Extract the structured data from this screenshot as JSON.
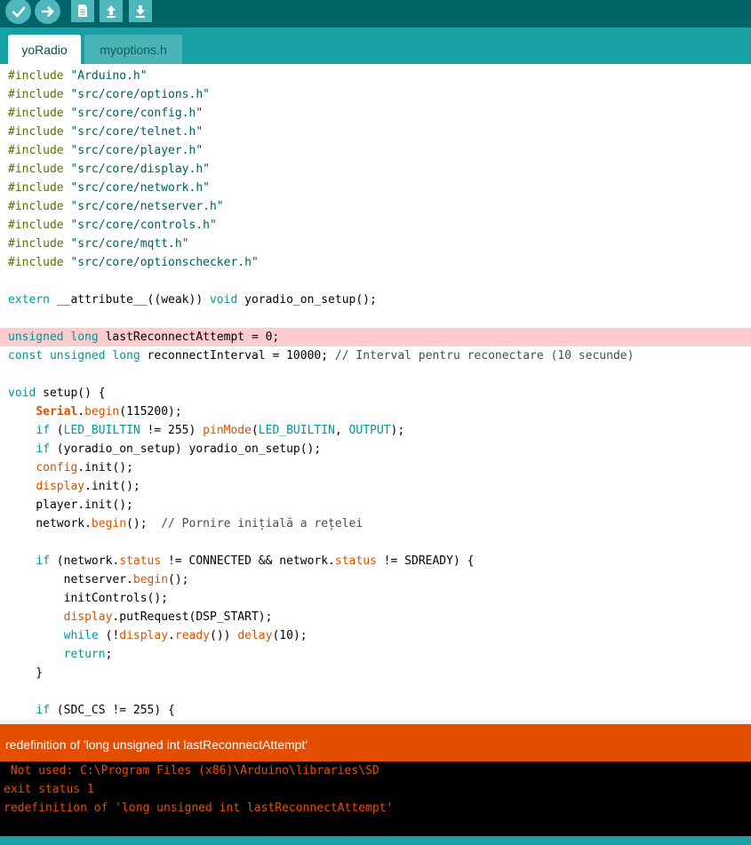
{
  "toolbar": {
    "buttons": [
      {
        "name": "verify-button",
        "icon": "checkmark-icon"
      },
      {
        "name": "upload-button",
        "icon": "arrow-right-icon"
      },
      {
        "name": "new-button",
        "icon": "document-icon"
      },
      {
        "name": "open-button",
        "icon": "arrow-up-icon"
      },
      {
        "name": "save-button",
        "icon": "arrow-down-icon"
      }
    ]
  },
  "tabs": [
    {
      "label": "yoRadio",
      "active": true
    },
    {
      "label": "myoptions.h",
      "active": false
    }
  ],
  "code": [
    "#include \"Arduino.h\"",
    "#include \"src/core/options.h\"",
    "#include \"src/core/config.h\"",
    "#include \"src/core/telnet.h\"",
    "#include \"src/core/player.h\"",
    "#include \"src/core/display.h\"",
    "#include \"src/core/network.h\"",
    "#include \"src/core/netserver.h\"",
    "#include \"src/core/controls.h\"",
    "#include \"src/core/mqtt.h\"",
    "#include \"src/core/optionschecker.h\"",
    "",
    "extern __attribute__((weak)) void yoradio_on_setup();",
    "",
    "unsigned long lastReconnectAttempt = 0;",
    "const unsigned long reconnectInterval = 10000; // Interval pentru reconectare (10 secunde)",
    "",
    "void setup() {",
    "    Serial.begin(115200);",
    "    if (LED_BUILTIN != 255) pinMode(LED_BUILTIN, OUTPUT);",
    "    if (yoradio_on_setup) yoradio_on_setup();",
    "    config.init();",
    "    display.init();",
    "    player.init();",
    "    network.begin();  // Pornire inițială a rețelei",
    "",
    "    if (network.status != CONNECTED && network.status != SDREADY) {",
    "        netserver.begin();",
    "        initControls();",
    "        display.putRequest(DSP_START);",
    "        while (!display.ready()) delay(10);",
    "        return;",
    "    }",
    "",
    "    if (SDC_CS != 255) {"
  ],
  "highlighted_line": 14,
  "status": {
    "message": "redefinition of 'long unsigned int lastReconnectAttempt'",
    "color": "#e54d00"
  },
  "console": [
    " Not used: C:\\Program Files (x86)\\Arduino\\libraries\\SD",
    "exit status 1",
    "redefinition of 'long unsigned int lastReconnectAttempt'"
  ],
  "colors": {
    "toolbar": "#006468",
    "tabbar": "#17a1a5",
    "keyword": "#00979c",
    "function": "#d35400",
    "preprocessor": "#5e6d03",
    "error_highlight": "#fdcccc"
  }
}
